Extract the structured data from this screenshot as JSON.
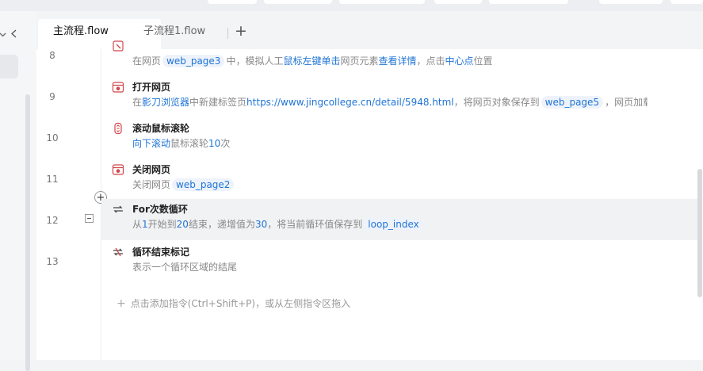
{
  "tabs": [
    {
      "label": "主流程.flow",
      "active": true
    },
    {
      "label": "子流程1.flow",
      "active": false
    }
  ],
  "add_tab_label": "+",
  "gutter_add_label": "+",
  "rows": [
    {
      "line": "8",
      "title": "",
      "icon": "mouse-click-icon",
      "desc": [
        {
          "t": "在网页"
        },
        {
          "t": "web_page3",
          "c": "var"
        },
        {
          "t": "中，模拟人工"
        },
        {
          "t": "鼠标左键单击",
          "c": "kw"
        },
        {
          "t": "网页元素"
        },
        {
          "t": "查看详情",
          "c": "kw"
        },
        {
          "t": "，点击"
        },
        {
          "t": "中心点",
          "c": "kw"
        },
        {
          "t": "位置"
        }
      ]
    },
    {
      "line": "9",
      "title": "打开网页",
      "icon": "browser-open-icon",
      "desc": [
        {
          "t": "在"
        },
        {
          "t": "影刀浏览器",
          "c": "kw"
        },
        {
          "t": "中新建标签页"
        },
        {
          "t": "https://www.jingcollege.cn/detail/5948.html",
          "c": "kw"
        },
        {
          "t": "，将网页对象保存到"
        },
        {
          "t": "web_page5",
          "c": "var"
        },
        {
          "t": "，网页加载超时后..."
        }
      ]
    },
    {
      "line": "10",
      "title": "滚动鼠标滚轮",
      "icon": "mouse-scroll-icon",
      "desc": [
        {
          "t": "向下滚动",
          "c": "kw"
        },
        {
          "t": "鼠标滚轮"
        },
        {
          "t": "10",
          "c": "kw"
        },
        {
          "t": "次"
        }
      ]
    },
    {
      "line": "11",
      "title": "关闭网页",
      "icon": "browser-close-icon",
      "desc": [
        {
          "t": "关闭网页"
        },
        {
          "t": "web_page2",
          "c": "var"
        }
      ]
    },
    {
      "line": "12",
      "title": "For次数循环",
      "icon": "loop-icon",
      "highlight": true,
      "desc": [
        {
          "t": "从"
        },
        {
          "t": "1",
          "c": "kw"
        },
        {
          "t": "开始到"
        },
        {
          "t": "20",
          "c": "kw"
        },
        {
          "t": "结束，递增值为"
        },
        {
          "t": "30",
          "c": "kw"
        },
        {
          "t": "，将当前循环值保存到"
        },
        {
          "t": "loop_index",
          "c": "var"
        }
      ]
    },
    {
      "line": "13",
      "title": "循环结束标记",
      "icon": "loop-end-icon",
      "desc": [
        {
          "t": "表示一个循环区域的结尾"
        }
      ]
    }
  ],
  "add_command": {
    "icon": "+",
    "text": "点击添加指令(Ctrl+Shift+P)，或从左侧指令区拖入"
  },
  "colors": {
    "keyword": "#1f74d6",
    "variable_bg": "#eef3fb",
    "icon_red": "#d0464a",
    "row_highlight": "#f1f2f4"
  }
}
